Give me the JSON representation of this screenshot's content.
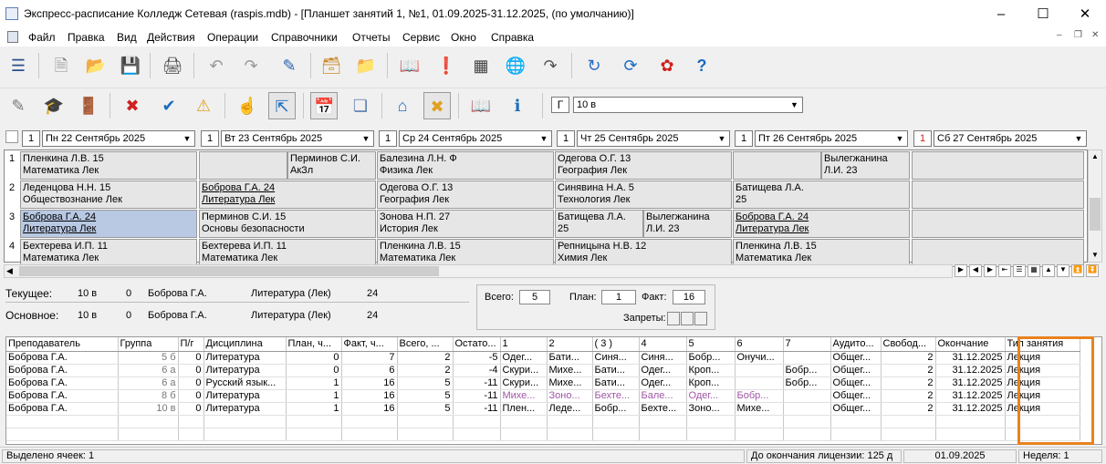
{
  "window": {
    "title": "Экспресс-расписание Колледж Сетевая (raspis.mdb) - [Планшет занятий 1, №1, 01.09.2025-31.12.2025, (по умолчанию)]"
  },
  "menu": [
    "Файл",
    "Правка",
    "Вид",
    "Действия",
    "Операции",
    "Справочники",
    "Отчеты",
    "Сервис",
    "Окно",
    "Справка"
  ],
  "group_select": {
    "prefix": "Г",
    "value": "10 в"
  },
  "days": [
    {
      "num": "1",
      "label": "Пн 22 Сентябрь 2025"
    },
    {
      "num": "1",
      "label": "Вт 23 Сентябрь 2025"
    },
    {
      "num": "1",
      "label": "Ср 24 Сентябрь 2025"
    },
    {
      "num": "1",
      "label": "Чт 25 Сентябрь 2025"
    },
    {
      "num": "1",
      "label": "Пт 26 Сентябрь 2025"
    },
    {
      "num": "1",
      "label": "Сб 27 Сентябрь 2025"
    }
  ],
  "timetable": [
    [
      [
        "Пленкина Л.В.   15",
        "Математика    Лек"
      ],
      [
        "",
        "",
        "Перминов С.И.",
        "АкЗл"
      ],
      [
        "Балезина Л.Н.   Ф",
        "Физика    Лек"
      ],
      [
        "Одегова О.Г.   13",
        "География    Лек"
      ],
      [
        "",
        "",
        "Вылегжанина",
        "Л.И.    23"
      ],
      [
        "",
        ""
      ]
    ],
    [
      [
        "Леденцова Н.Н.   15",
        "Обществознание    Лек"
      ],
      [
        "Боброва Г.А.    24",
        "Литература    Лек"
      ],
      [
        "Одегова О.Г.   13",
        "География    Лек"
      ],
      [
        "Синявина Н.А.   5",
        "Технология    Лек"
      ],
      [
        "Батищева Л.А.",
        "25"
      ],
      [
        "",
        ""
      ]
    ],
    [
      [
        "Боброва Г.А.    24",
        "Литература    Лек"
      ],
      [
        "Перминов С.И.   15",
        "Основы безопасности"
      ],
      [
        "Зонова Н.П.    27",
        "История    Лек"
      ],
      [
        "Батищева Л.А.",
        "25",
        "Вылегжанина",
        "Л.И.    23"
      ],
      [
        "Боброва Г.А.    24",
        "Литература    Лек"
      ],
      [
        "",
        ""
      ]
    ],
    [
      [
        "Бехтерева И.П.   11",
        "Математика    Лек"
      ],
      [
        "Бехтерева И.П.   11",
        "Математика    Лек"
      ],
      [
        "Пленкина Л.В.   15",
        "Математика    Лек"
      ],
      [
        "Репницына Н.В.   12",
        "Химия    Лек"
      ],
      [
        "Пленкина Л.В.   15",
        "Математика    Лек"
      ],
      [
        "",
        ""
      ]
    ]
  ],
  "info": {
    "current_label": "Текущее:",
    "current_group": "10 в",
    "current_sub": "0",
    "current_teacher": "Боброва Г.А.",
    "current_subject": "Литература (Лек)",
    "current_room": "24",
    "main_label": "Основное:",
    "main_group": "10 в",
    "main_sub": "0",
    "main_teacher": "Боброва Г.А.",
    "main_subject": "Литература (Лек)",
    "main_room": "24"
  },
  "counters": {
    "total_label": "Всего:",
    "total": "5",
    "plan_label": "План:",
    "plan": "1",
    "fact_label": "Факт:",
    "fact": "16",
    "ban_label": "Запреты:"
  },
  "table": {
    "headers": [
      "Преподаватель",
      "Группа",
      "П/г",
      "Дисциплина",
      "План, ч...",
      "Факт, ч...",
      "Всего, ...",
      "Остато...",
      "1",
      "2",
      "( 3 )",
      "4",
      "5",
      "6",
      "7",
      "Аудито...",
      "Свобод...",
      "Окончание",
      "Тип занятия"
    ],
    "rows": [
      [
        "Боброва Г.А.",
        "5 б",
        "0",
        "Литература",
        "0",
        "7",
        "2",
        "-5",
        "Одег...",
        "Бати...",
        "Синя...",
        "Синя...",
        "Бобр...",
        "Онучи...",
        "",
        "Общег...",
        "2",
        "31.12.2025",
        "Лекция"
      ],
      [
        "Боброва Г.А.",
        "6 а",
        "0",
        "Литература",
        "0",
        "6",
        "2",
        "-4",
        "Скури...",
        "Михе...",
        "Бати...",
        "Одег...",
        "Кроп...",
        "",
        "Бобр...",
        "Общег...",
        "2",
        "31.12.2025",
        "Лекция"
      ],
      [
        "Боброва Г.А.",
        "6 а",
        "0",
        "Русский язык...",
        "1",
        "16",
        "5",
        "-11",
        "Скури...",
        "Михе...",
        "Бати...",
        "Одег...",
        "Кроп...",
        "",
        "Бобр...",
        "Общег...",
        "2",
        "31.12.2025",
        "Лекция"
      ],
      [
        "Боброва Г.А.",
        "8 б",
        "0",
        "Литература",
        "1",
        "16",
        "5",
        "-11",
        "Михе...",
        "Зоно...",
        "Бехте...",
        "Бале...",
        "Одег...",
        "Бобр...",
        "",
        "Общег...",
        "2",
        "31.12.2025",
        "Лекция"
      ],
      [
        "Боброва Г.А.",
        "10 в",
        "0",
        "Литература",
        "1",
        "16",
        "5",
        "-11",
        "Плен...",
        "Леде...",
        "Бобр...",
        "Бехте...",
        "Зоно...",
        "Михе...",
        "",
        "Общег...",
        "2",
        "31.12.2025",
        "Лекция"
      ]
    ]
  },
  "status": {
    "selected": "Выделено ячеек: 1",
    "license": "До окончания лицензии: 125 д",
    "date": "01.09.2025",
    "week": "Неделя: 1"
  },
  "colors": {
    "accent": "#e8821e",
    "selection": "#b9c9e4",
    "purple": "#a056a6"
  }
}
